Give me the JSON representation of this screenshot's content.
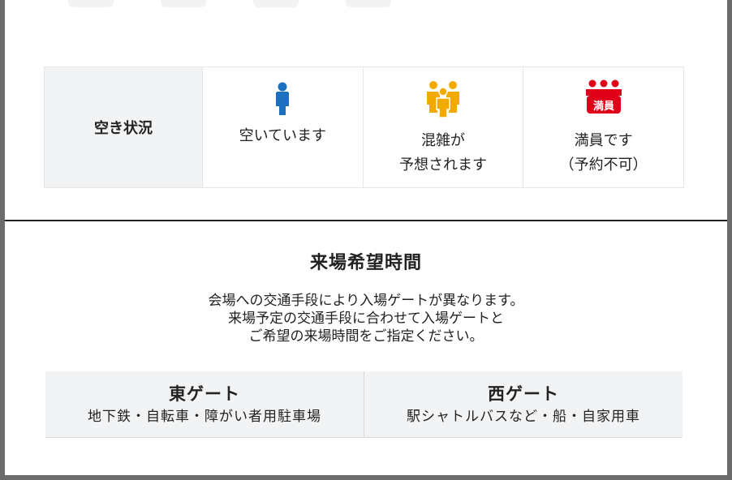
{
  "legend": {
    "label": "空き状況",
    "items": [
      {
        "icon": "person-icon",
        "color": "#1d6fc0",
        "text": "空いています"
      },
      {
        "icon": "crowd-icon",
        "color": "#f2a900",
        "text": "混雑が\n予想されます"
      },
      {
        "icon": "full-crowd-icon",
        "color": "#e0001a",
        "badge": "満員",
        "text": "満員です\n（予約不可）"
      }
    ]
  },
  "section": {
    "title": "来場希望時間",
    "lines": [
      "会場への交通手段により入場ゲートが異なります。",
      "来場予定の交通手段に合わせて入場ゲートと",
      "ご希望の来場時間をご指定ください。"
    ]
  },
  "gates": [
    {
      "name": "東ゲート",
      "desc": "地下鉄・自転車・障がい者用駐車場"
    },
    {
      "name": "西ゲート",
      "desc": "駅シャトルバスなど・船・自家用車"
    }
  ]
}
